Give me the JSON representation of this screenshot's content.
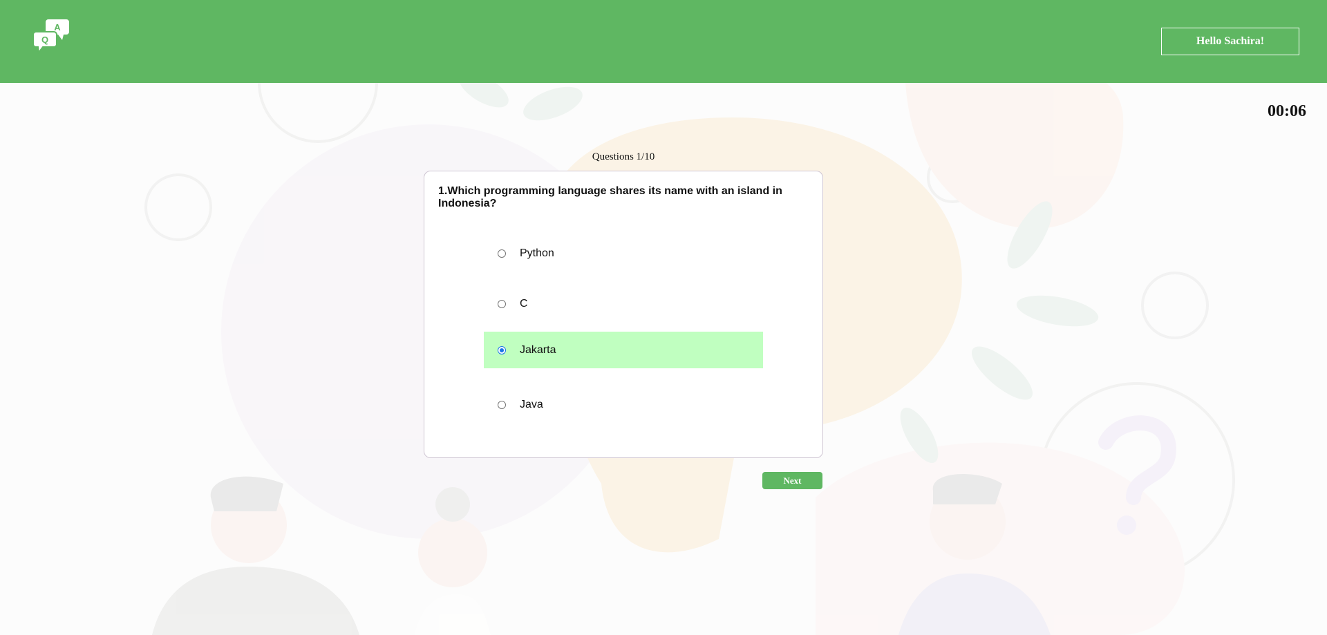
{
  "header": {
    "logo_icon": "qa-chat-bubbles-icon",
    "logo_letter_q": "Q",
    "logo_letter_a": "A",
    "greeting": "Hello Sachira!"
  },
  "timer": "00:06",
  "quiz": {
    "counter": "Questions 1/10",
    "question": "1.Which programming language shares its name with an island in Indonesia?",
    "options": [
      {
        "label": "Python",
        "selected": false
      },
      {
        "label": "C",
        "selected": false
      },
      {
        "label": "Jakarta",
        "selected": true
      },
      {
        "label": "Java",
        "selected": false
      }
    ],
    "next_label": "Next"
  },
  "colors": {
    "brand_green": "#5fb762",
    "selected_option_bg": "#c0ffc0",
    "radio_checked": "#1a73e8"
  }
}
